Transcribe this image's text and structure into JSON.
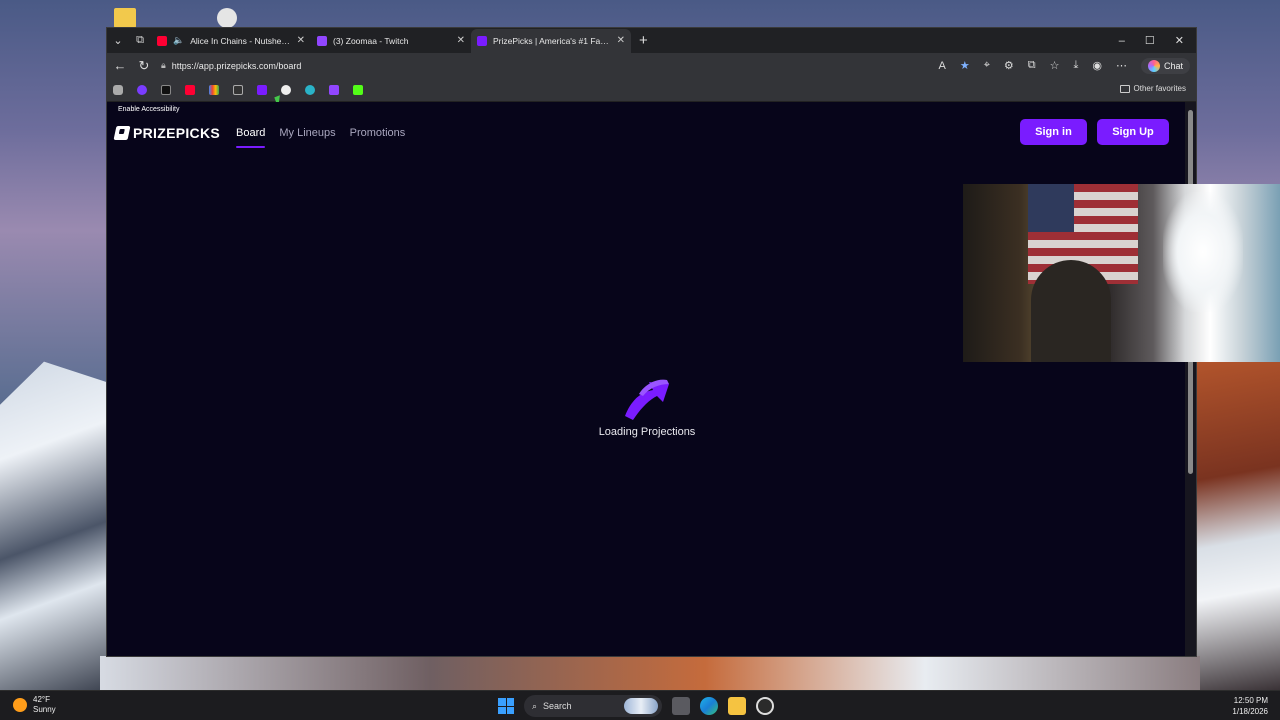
{
  "desktop": {
    "icons": [
      "folder-icon",
      "file-icon"
    ]
  },
  "browser": {
    "tabs": [
      {
        "title": "Alice In Chains - Nutshell (MTV",
        "icon": "youtube-icon",
        "muted_icon": "speaker-icon"
      },
      {
        "title": "(3) Zoomaa - Twitch",
        "icon": "twitch-icon"
      },
      {
        "title": "PrizePicks | America's #1 Fantasy S",
        "icon": "prizepicks-icon",
        "active": true
      }
    ],
    "new_tab": "+",
    "window_controls": {
      "minimize": "–",
      "maximize": "☐",
      "close": "✕"
    },
    "url": "https://app.prizepicks.com/board",
    "chat_label": "Chat",
    "favorites": {
      "items": [
        "camera-icon",
        "purple-app-icon",
        "x-icon",
        "youtube-icon",
        "google-icon",
        "roblox-icon",
        "prizepicks-icon",
        "github-icon",
        "cyan-app-icon",
        "twitch-icon",
        "kick-icon"
      ],
      "other_label": "Other favorites"
    }
  },
  "page": {
    "accessibility_text": "Enable Accessibility",
    "logo_text": "PRIZEPICKS",
    "nav": [
      {
        "label": "Board",
        "active": true
      },
      {
        "label": "My Lineups"
      },
      {
        "label": "Promotions"
      }
    ],
    "sign_in": "Sign in",
    "sign_up": "Sign Up",
    "loading_text": "Loading Projections",
    "accent": "#7a1cff",
    "background": "#07051a"
  },
  "taskbar": {
    "weather_temp": "42°F",
    "weather_desc": "Sunny",
    "search_label": "Search",
    "time": "12:50 PM",
    "date": "1/18/2026"
  }
}
